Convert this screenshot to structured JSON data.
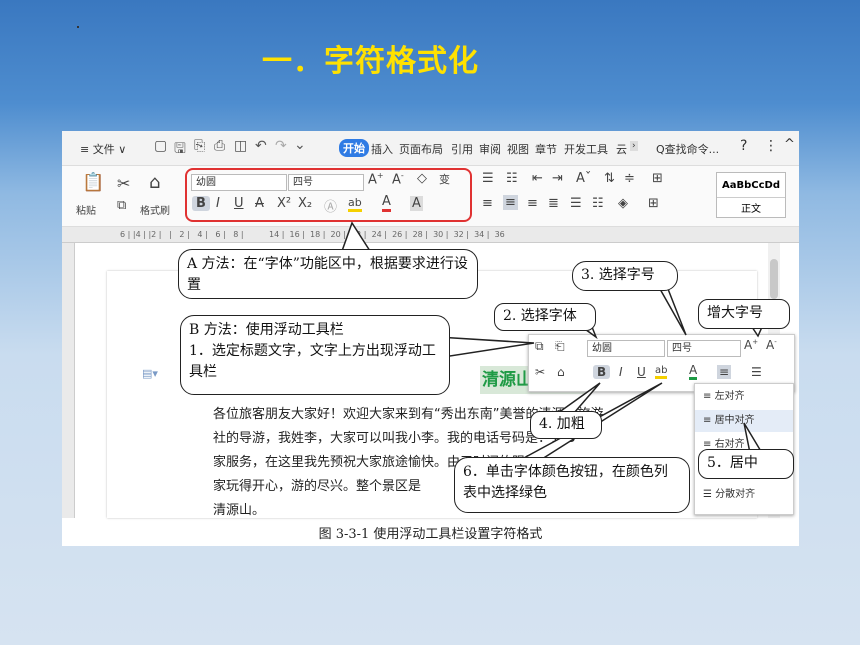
{
  "slide": {
    "title": "一．字符格式化"
  },
  "menubar": {
    "menu_label": "≡ 文件 ∨",
    "tabs": [
      "开始",
      "插入",
      "页面布局",
      "引用",
      "审阅",
      "视图",
      "章节",
      "开发工具",
      "云"
    ],
    "search": "Q查找命令...",
    "help": "?",
    "more": "⋮"
  },
  "ribbon": {
    "paste": "粘贴",
    "format_painter": "格式刷",
    "font_name": "幼圆",
    "font_size": "四号",
    "style_preview": "AaBbCcDd",
    "style_name": "正文"
  },
  "ruler": {
    "marks": "6 | |4 | |2 |   |   2 |   4 |   6 |   8 |          14 |  16 |  18 |  20 |  22 |  24 |  26 |  28 |  30 |  32 |  34 |  36"
  },
  "floatbar": {
    "font_name": "幼圆",
    "font_size": "四号"
  },
  "document": {
    "heading": "清源山",
    "lines": [
      "各位旅客朋友大家好！欢迎大家来到有“秀出东南”美誉的清源山旅游",
      "社的导游，我姓李，大家可以叫我小李。我的电话号码是：135",
      "家服务，在这里我先预祝大家旅途愉快。由于时间的限制，",
      "家玩得开心，游的尽兴。整个景区是",
      "清源山。"
    ]
  },
  "align_menu": {
    "items": [
      "左对齐",
      "居中对齐",
      "右对齐",
      "",
      "分散对齐"
    ]
  },
  "callouts": {
    "a": "A 方法：在“字体”功能区中，根据要求进行设置",
    "b": "B 方法：使用浮动工具栏",
    "b1": "1．选定标题文字，文字上方出现浮动工具栏",
    "step2": "2. 选择字体",
    "step3": "3. 选择字号",
    "enlarge": "增大字号",
    "step4": "4. 加粗",
    "step5": "5．居中",
    "step6": "6．单击字体颜色按钮，在颜色列表中选择绿色"
  },
  "caption": "图 3-3-1  使用浮动工具栏设置字符格式",
  "colors": {
    "title": "#ffe100",
    "heading_green": "#1f9a45",
    "accent_red": "#e03232",
    "tab_blue": "#2f7be4"
  }
}
